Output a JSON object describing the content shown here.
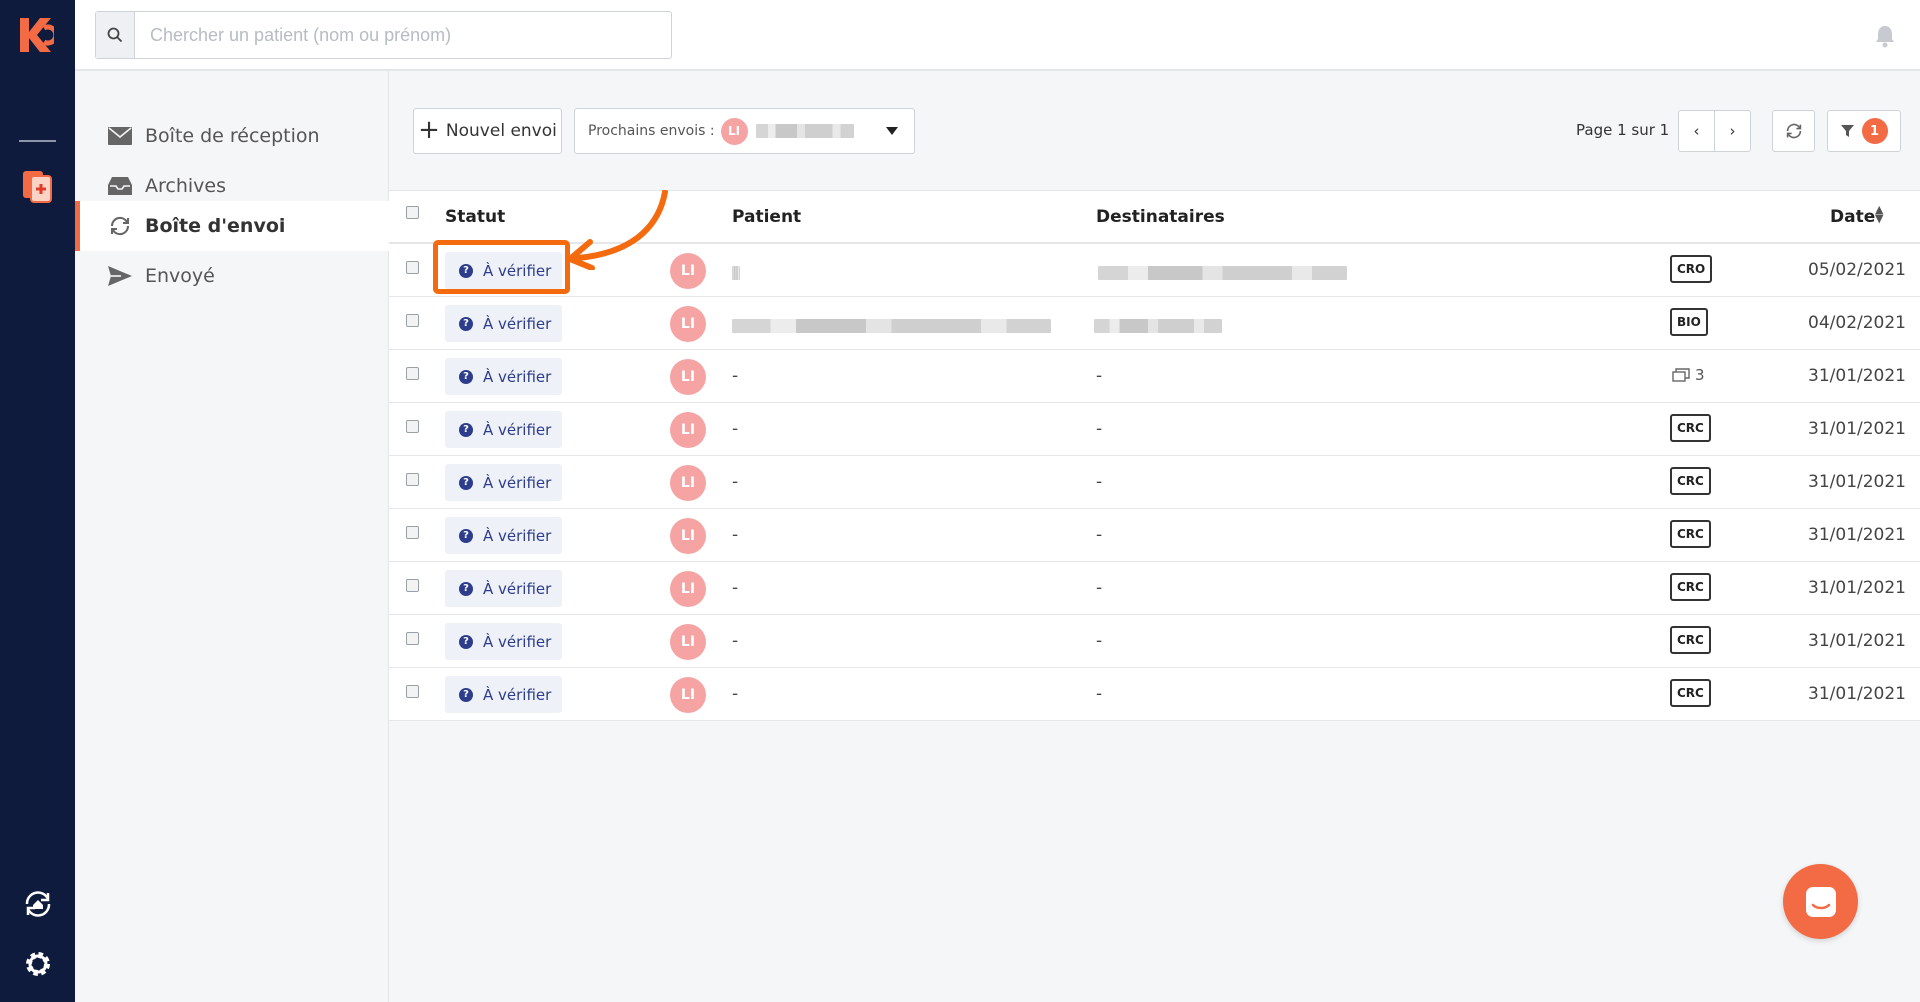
{
  "search": {
    "placeholder": "Chercher un patient (nom ou prénom)"
  },
  "sidebar": {
    "items": [
      {
        "label": "Boîte de réception",
        "icon": "envelope-icon",
        "active": false
      },
      {
        "label": "Archives",
        "icon": "inbox-tray-icon",
        "active": false
      },
      {
        "label": "Boîte d'envoi",
        "icon": "sync-icon",
        "active": true
      },
      {
        "label": "Envoyé",
        "icon": "paper-plane-icon",
        "active": false
      }
    ]
  },
  "toolbar": {
    "new_label": "Nouvel envoi",
    "upcoming_label": "Prochains envois :",
    "upcoming_avatar": "LI",
    "pager_text": "Page 1 sur 1",
    "prev_label": "‹",
    "next_label": "›",
    "filter_count": "1"
  },
  "table": {
    "headers": {
      "status": "Statut",
      "patient": "Patient",
      "recipients": "Destinataires",
      "date": "Date"
    },
    "rows": [
      {
        "status": "À vérifier",
        "avatar": "LI",
        "patient": "",
        "recipients": "",
        "doc": "CRO",
        "date": "05/02/2021"
      },
      {
        "status": "À vérifier",
        "avatar": "LI",
        "patient": "",
        "recipients": "",
        "doc": "BIO",
        "date": "04/02/2021"
      },
      {
        "status": "À vérifier",
        "avatar": "LI",
        "patient": "-",
        "recipients": "-",
        "doc_count": "3",
        "date": "31/01/2021"
      },
      {
        "status": "À vérifier",
        "avatar": "LI",
        "patient": "-",
        "recipients": "-",
        "doc": "CRC",
        "date": "31/01/2021"
      },
      {
        "status": "À vérifier",
        "avatar": "LI",
        "patient": "-",
        "recipients": "-",
        "doc": "CRC",
        "date": "31/01/2021"
      },
      {
        "status": "À vérifier",
        "avatar": "LI",
        "patient": "-",
        "recipients": "-",
        "doc": "CRC",
        "date": "31/01/2021"
      },
      {
        "status": "À vérifier",
        "avatar": "LI",
        "patient": "-",
        "recipients": "-",
        "doc": "CRC",
        "date": "31/01/2021"
      },
      {
        "status": "À vérifier",
        "avatar": "LI",
        "patient": "-",
        "recipients": "-",
        "doc": "CRC",
        "date": "31/01/2021"
      },
      {
        "status": "À vérifier",
        "avatar": "LI",
        "patient": "-",
        "recipients": "-",
        "doc": "CRC",
        "date": "31/01/2021"
      }
    ]
  },
  "colors": {
    "rail": "#0f1b3d",
    "accent": "#f36b45",
    "status_text": "#2d3d8b",
    "annotation": "#f36b0e"
  }
}
